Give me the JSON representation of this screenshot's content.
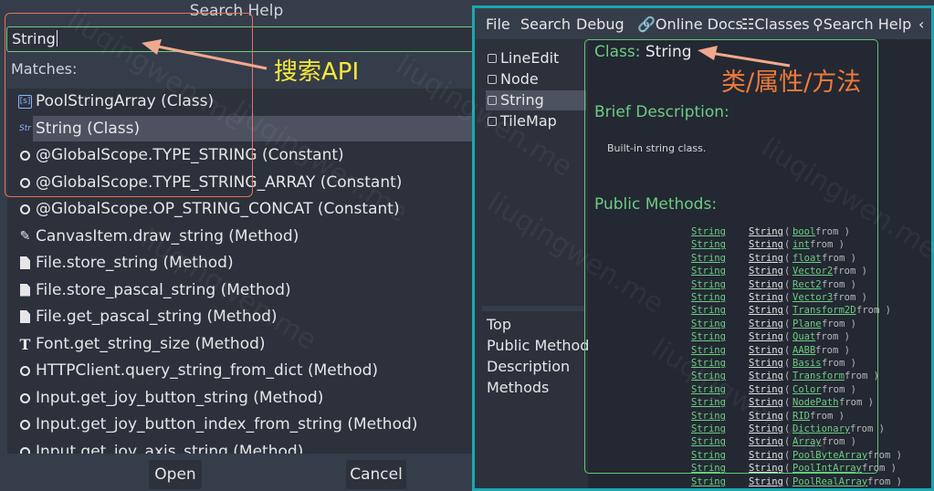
{
  "search_dialog": {
    "title": "Search Help",
    "query": "String",
    "matches_label": "Matches:",
    "results": [
      {
        "icon": "pool-string-array-icon",
        "label": "PoolStringArray (Class)"
      },
      {
        "icon": "string-class-icon",
        "label": "String (Class)",
        "selected": true
      },
      {
        "icon": "constant-icon",
        "label": "@GlobalScope.TYPE_STRING (Constant)"
      },
      {
        "icon": "constant-icon",
        "label": "@GlobalScope.TYPE_STRING_ARRAY (Constant)"
      },
      {
        "icon": "constant-icon",
        "label": "@GlobalScope.OP_STRING_CONCAT (Constant)"
      },
      {
        "icon": "pencil-icon",
        "label": "CanvasItem.draw_string (Method)"
      },
      {
        "icon": "file-icon",
        "label": "File.store_string (Method)"
      },
      {
        "icon": "file-icon",
        "label": "File.store_pascal_string (Method)"
      },
      {
        "icon": "file-icon",
        "label": "File.get_pascal_string (Method)"
      },
      {
        "icon": "font-icon",
        "label": "Font.get_string_size (Method)"
      },
      {
        "icon": "object-icon",
        "label": "HTTPClient.query_string_from_dict (Method)"
      },
      {
        "icon": "object-icon",
        "label": "Input.get_joy_button_string (Method)"
      },
      {
        "icon": "object-icon",
        "label": "Input.get_joy_button_index_from_string (Method)"
      },
      {
        "icon": "object-icon",
        "label": "Input.get_joy_axis_string (Method)"
      }
    ],
    "open_label": "Open",
    "cancel_label": "Cancel"
  },
  "annotations": {
    "search_api": "搜索API",
    "class_property_method": "类/属性/方法"
  },
  "menubar": {
    "file": "File",
    "search": "Search",
    "debug": "Debug",
    "online_docs": "Online Docs",
    "classes": "Classes",
    "search_help": "Search Help"
  },
  "class_tree": {
    "items": [
      {
        "label": "LineEdit"
      },
      {
        "label": "Node"
      },
      {
        "label": "String",
        "selected": true
      },
      {
        "label": "TileMap"
      }
    ]
  },
  "outline": {
    "items": [
      "Top",
      "Public Methods",
      "Description",
      "Methods"
    ]
  },
  "doc": {
    "class_key": "Class:",
    "class_name": "String",
    "brief_heading": "Brief Description:",
    "brief_text": "Built-in string class.",
    "methods_heading": "Public Methods:",
    "methods": [
      {
        "ret": "String",
        "name": "String",
        "type": "bool",
        "rest": " from )"
      },
      {
        "ret": "String",
        "name": "String",
        "type": "int",
        "rest": " from )"
      },
      {
        "ret": "String",
        "name": "String",
        "type": "float",
        "rest": " from )"
      },
      {
        "ret": "String",
        "name": "String",
        "type": "Vector2",
        "rest": " from )"
      },
      {
        "ret": "String",
        "name": "String",
        "type": "Rect2",
        "rest": " from )"
      },
      {
        "ret": "String",
        "name": "String",
        "type": "Vector3",
        "rest": " from )"
      },
      {
        "ret": "String",
        "name": "String",
        "type": "Transform2D",
        "rest": " from )"
      },
      {
        "ret": "String",
        "name": "String",
        "type": "Plane",
        "rest": " from )"
      },
      {
        "ret": "String",
        "name": "String",
        "type": "Quat",
        "rest": " from )"
      },
      {
        "ret": "String",
        "name": "String",
        "type": "AABB",
        "rest": " from )"
      },
      {
        "ret": "String",
        "name": "String",
        "type": "Basis",
        "rest": " from )"
      },
      {
        "ret": "String",
        "name": "String",
        "type": "Transform",
        "rest": " from )"
      },
      {
        "ret": "String",
        "name": "String",
        "type": "Color",
        "rest": " from )"
      },
      {
        "ret": "String",
        "name": "String",
        "type": "NodePath",
        "rest": " from )"
      },
      {
        "ret": "String",
        "name": "String",
        "type": "RID",
        "rest": " from )"
      },
      {
        "ret": "String",
        "name": "String",
        "type": "Dictionary",
        "rest": " from )"
      },
      {
        "ret": "String",
        "name": "String",
        "type": "Array",
        "rest": " from )"
      },
      {
        "ret": "String",
        "name": "String",
        "type": "PoolByteArray",
        "rest": " from )"
      },
      {
        "ret": "String",
        "name": "String",
        "type": "PoolIntArray",
        "rest": " from )"
      },
      {
        "ret": "String",
        "name": "String",
        "type": "PoolRealArray",
        "rest": " from )"
      }
    ]
  },
  "watermark": "liuqingwen.me",
  "colors": {
    "accent_green": "#6dcc82",
    "annotation_yellow": "#f5e93a",
    "annotation_orange": "#f07a3a",
    "window_border": "#1aa7b3"
  }
}
